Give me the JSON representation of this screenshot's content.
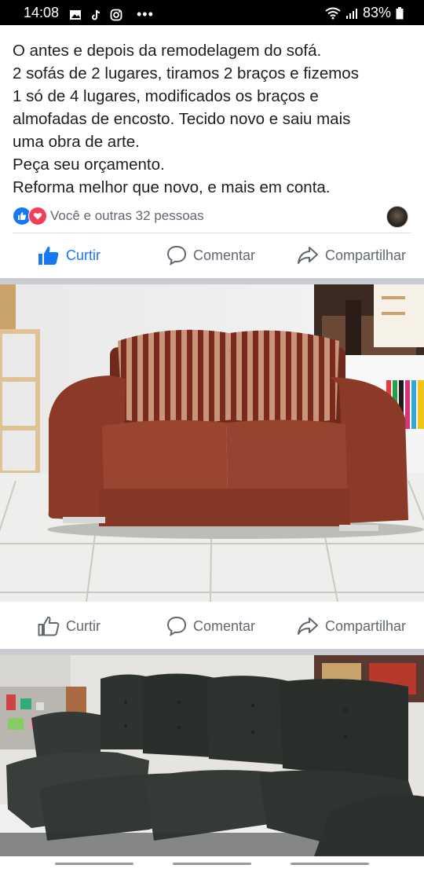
{
  "status_bar": {
    "time": "14:08",
    "battery": "83%"
  },
  "post": {
    "lines": [
      "O antes e depois da remodelagem do sofá.",
      "2 sofás de 2 lugares, tiramos 2 braços e fizemos",
      "1 só de 4 lugares, modificados os braços e",
      "almofadas de encosto. Tecido novo e saiu mais",
      "uma obra de arte.",
      "Peça seu orçamento.",
      "Reforma melhor que novo, e mais em conta."
    ],
    "reactions_text": "Você e outras 32 pessoas"
  },
  "actions": {
    "like": "Curtir",
    "comment": "Comentar",
    "share": "Compartilhar"
  },
  "colors": {
    "accent": "#1877f2",
    "love": "#f33e58",
    "muted": "#606770"
  }
}
